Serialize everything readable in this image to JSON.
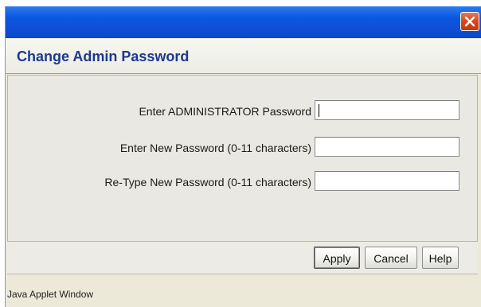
{
  "dialog": {
    "title": "Change Admin Password",
    "close_icon": "close-icon"
  },
  "form": {
    "fields": [
      {
        "label": "Enter ADMINISTRATOR Password",
        "value": ""
      },
      {
        "label": "Enter New Password (0-11 characters)",
        "value": ""
      },
      {
        "label": "Re-Type New Password (0-11 characters)",
        "value": ""
      }
    ]
  },
  "buttons": {
    "apply": "Apply",
    "cancel": "Cancel",
    "help": "Help"
  },
  "status": {
    "text": "Java Applet Window"
  },
  "colors": {
    "titlebar": "#0a58e0",
    "close_button": "#d2431d",
    "title_text": "#1c3a8c",
    "window_bg": "#ece9d8"
  }
}
